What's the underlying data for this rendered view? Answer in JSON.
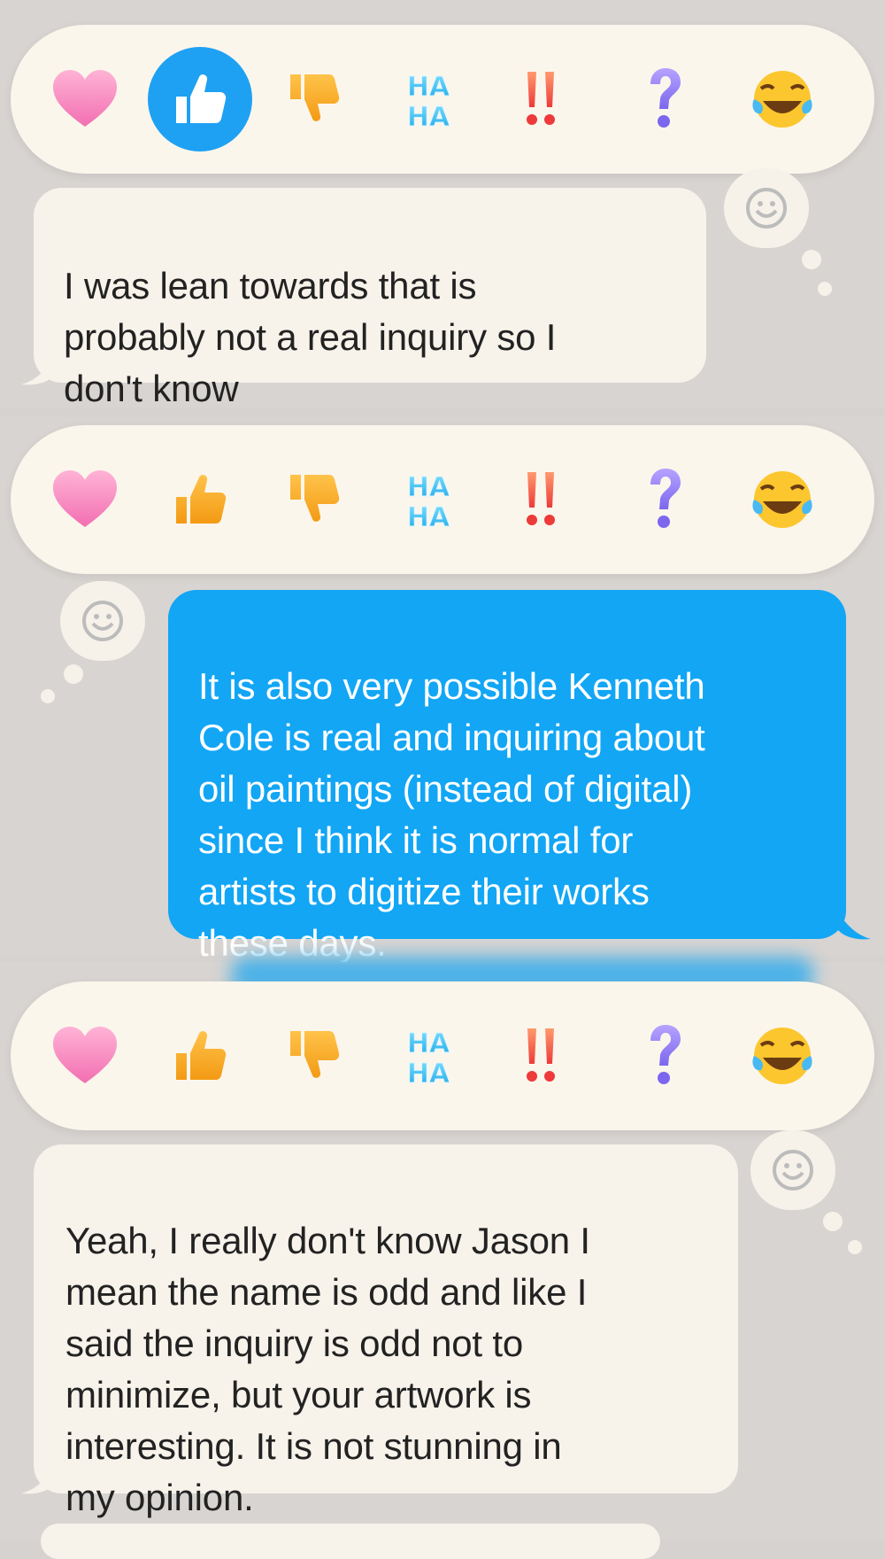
{
  "reactions": [
    "heart-icon",
    "thumbs-up-icon",
    "thumbs-down-icon",
    "haha-icon",
    "exclamation-icon",
    "question-icon",
    "laughing-emoji-icon"
  ],
  "haha_text": "HA HA",
  "panels": [
    {
      "selected_reaction": "thumbs-up",
      "message": {
        "direction": "incoming",
        "text": "I was lean towards that is\nprobably not a real inquiry so I\ndon't know"
      }
    },
    {
      "selected_reaction": "",
      "message": {
        "direction": "outgoing",
        "text": "It is also very possible Kenneth\nCole is real and inquiring about\noil paintings (instead of digital)\nsince I think it is normal for\nartists to digitize their works\nthese days."
      }
    },
    {
      "selected_reaction": "",
      "message": {
        "direction": "incoming",
        "text": "Yeah, I really don't know Jason I\nmean the name is odd and like I\nsaid the inquiry is odd not to\nminimize, but your artwork is\ninteresting. It is not stunning in\nmy opinion."
      }
    }
  ],
  "colors": {
    "selected_reaction": "#1ea1f3",
    "outgoing_bubble": "#12a6f5",
    "incoming_bubble": "#f7f2ea",
    "tapback_bar": "#fbf6ec"
  }
}
